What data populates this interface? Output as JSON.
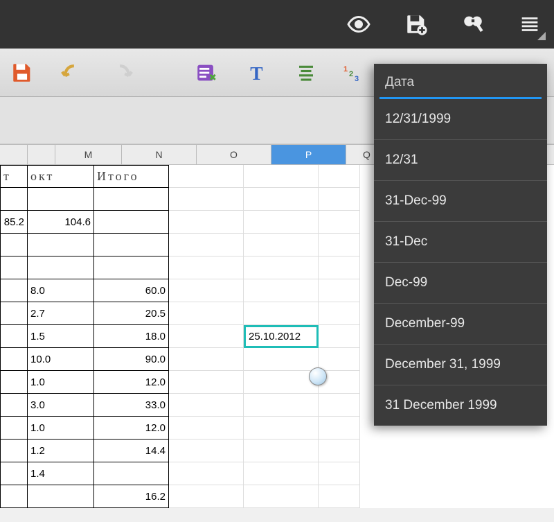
{
  "dropdown": {
    "title": "Дата",
    "items": [
      "12/31/1999",
      "12/31",
      "31-Dec-99",
      "31-Dec",
      "Dec-99",
      "December-99",
      "December 31, 1999",
      "31 December 1999"
    ]
  },
  "columns": [
    "",
    "M",
    "N",
    "O",
    "P",
    "Q"
  ],
  "selected_column": "P",
  "headers": {
    "L": "т",
    "M": "окт",
    "N": "Итого"
  },
  "row3": {
    "L": "85.2",
    "M": "104.6"
  },
  "rows": [
    {
      "M": "8.0",
      "N": "60.0"
    },
    {
      "M": "2.7",
      "N": "20.5"
    },
    {
      "M": "1.5",
      "N": "18.0"
    },
    {
      "M": "10.0",
      "N": "90.0"
    },
    {
      "M": "1.0",
      "N": "12.0"
    },
    {
      "M": "3.0",
      "N": "33.0"
    },
    {
      "M": "1.0",
      "N": "12.0"
    },
    {
      "M": "1.2",
      "N": "14.4"
    },
    {
      "M": "1.4",
      "N": ""
    },
    {
      "M": "",
      "N": "16.2"
    }
  ],
  "selected_cell_value": "25.10.2012"
}
